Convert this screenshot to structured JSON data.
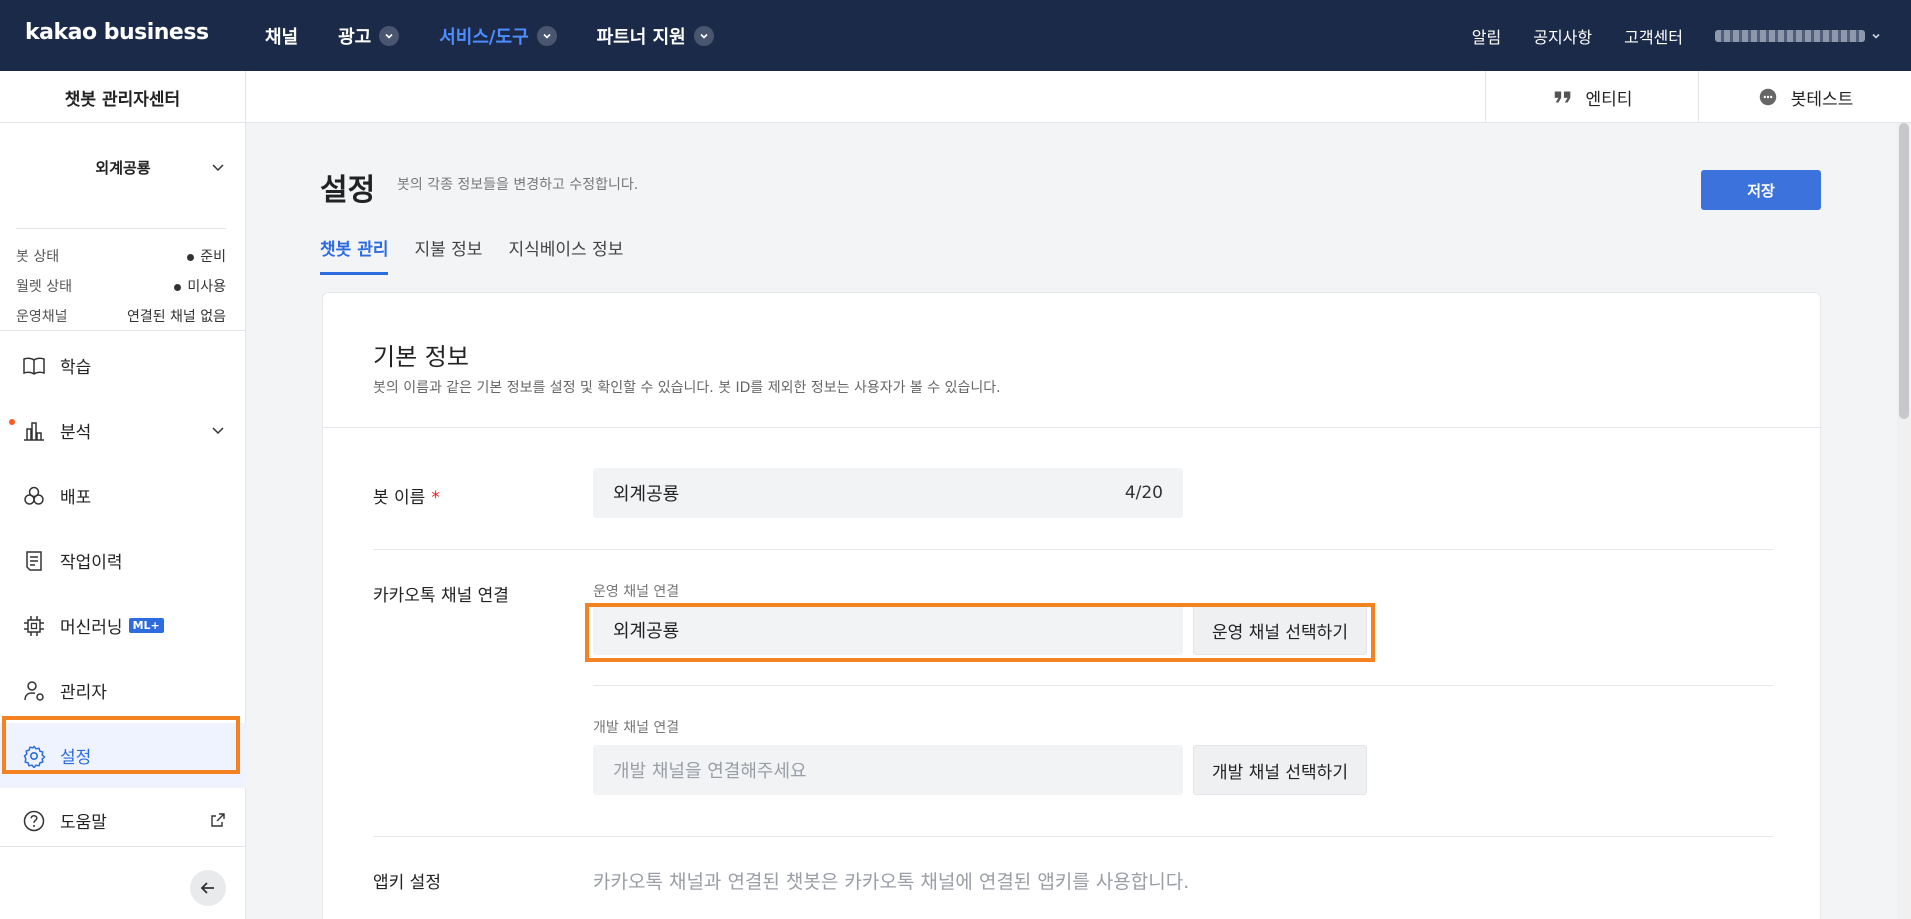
{
  "topnav": {
    "logo": "kakao business",
    "items": [
      {
        "label": "채널"
      },
      {
        "label": "광고"
      },
      {
        "label": "서비스/도구"
      },
      {
        "label": "파트너 지원"
      }
    ],
    "utilities": [
      "알림",
      "공지사항",
      "고객센터"
    ]
  },
  "subbar": {
    "center_title": "챗봇 관리자센터",
    "tools": [
      {
        "label": "엔티티",
        "icon": "quote-icon"
      },
      {
        "label": "봇테스트",
        "icon": "chat-bubble-icon"
      }
    ]
  },
  "sidebar": {
    "bot_name": "외계공룡",
    "status": [
      {
        "label": "봇 상태",
        "value": "준비"
      },
      {
        "label": "월렛 상태",
        "value": "미사용"
      },
      {
        "label": "운영채널",
        "value": "연결된 채널 없음"
      }
    ],
    "menu": [
      {
        "label": "학습",
        "icon": "book-icon"
      },
      {
        "label": "분석",
        "icon": "bar-chart-icon"
      },
      {
        "label": "배포",
        "icon": "deploy-icon"
      },
      {
        "label": "작업이력",
        "icon": "document-icon"
      },
      {
        "label": "머신러닝",
        "icon": "chip-icon",
        "badge": "ML+"
      },
      {
        "label": "관리자",
        "icon": "user-gear-icon"
      },
      {
        "label": "설정",
        "icon": "gear-icon"
      },
      {
        "label": "도움말",
        "icon": "help-icon"
      }
    ]
  },
  "main": {
    "title": "설정",
    "description": "봇의 각종 정보들을 변경하고 수정합니다.",
    "save_label": "저장",
    "tabs": [
      "챗봇 관리",
      "지불 정보",
      "지식베이스 정보"
    ],
    "section": {
      "title": "기본 정보",
      "description": "봇의 이름과 같은 기본 정보를 설정 및 확인할 수 있습니다. 봇 ID를 제외한 정보는 사용자가 볼 수 있습니다.",
      "bot_name_label": "봇 이름",
      "required_mark": "*",
      "bot_name_value": "외계공룡",
      "bot_name_count": "4/20",
      "channel_label": "카카오톡 채널 연결",
      "op_channel_label": "운영 채널 연결",
      "op_channel_value": "외계공룡",
      "op_channel_button": "운영 채널 선택하기",
      "dev_channel_label": "개발 채널 연결",
      "dev_channel_placeholder": "개발 채널을 연결해주세요",
      "dev_channel_button": "개발 채널 선택하기",
      "appkey_label": "앱키 설정",
      "appkey_desc": "카카오톡 채널과 연결된 챗봇은 카카오톡 채널에 연결된 앱키를 사용합니다."
    }
  },
  "colors": {
    "nav_bg": "#1c2a4a",
    "accent": "#2d6ce0",
    "highlight": "#f58220",
    "save_button": "#3b72db"
  }
}
